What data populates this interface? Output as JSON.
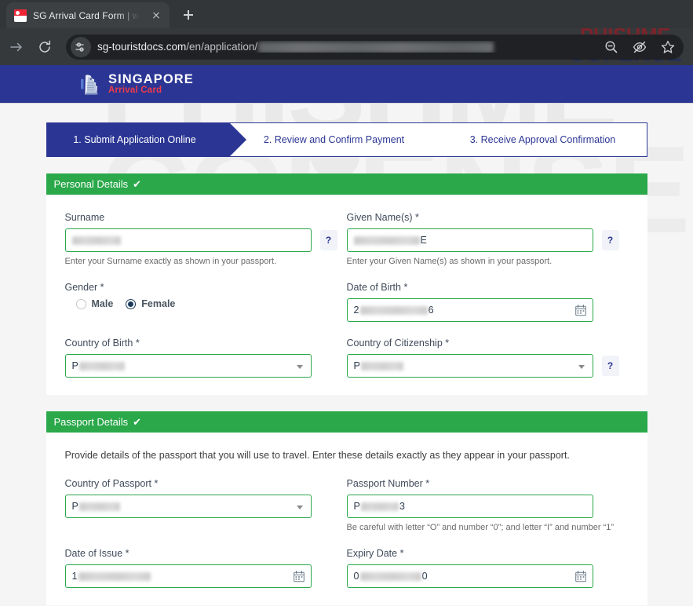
{
  "browser": {
    "tab": {
      "title": "SG Arrival Card Form | www.sg-",
      "favicon": "singapore-flag-icon"
    },
    "new_tab_label": "+",
    "toolbar": {
      "back_icon": "arrow-forward-icon",
      "reload_icon": "reload-icon",
      "site_settings_icon": "tune-icon",
      "zoom_out_icon": "zoom-out-icon",
      "eye_off_icon": "eye-off-icon",
      "bookmark_icon": "star-icon"
    },
    "url": {
      "host": "sg-touristdocs.com",
      "path": "/en/application/",
      "redacted_tail": true
    }
  },
  "watermark": {
    "line1": "PHISHME",
    "line2": "COFENSE"
  },
  "site": {
    "logo_line1": "SINGAPORE",
    "logo_line2": "Arrival Card",
    "logo_icon": "merlion-statue-icon"
  },
  "stepper": {
    "steps": [
      {
        "label": "1. Submit Application Online",
        "active": true
      },
      {
        "label": "2. Review and Confirm Payment",
        "active": false
      },
      {
        "label": "3. Receive Approval Confirmation",
        "active": false
      }
    ]
  },
  "personal_details": {
    "title": "Personal Details",
    "check": "✔",
    "surname": {
      "label": "Surname",
      "value": "",
      "value_redacted": true,
      "help": "Enter your Surname exactly as shown in your passport.",
      "help_icon": "?"
    },
    "given_names": {
      "label": "Given Name(s) *",
      "value_suffix": "E",
      "value_redacted": true,
      "help": "Enter your Given Name(s) as shown in your passport.",
      "help_icon": "?"
    },
    "gender": {
      "label": "Gender *",
      "options": [
        {
          "label": "Male",
          "selected": false
        },
        {
          "label": "Female",
          "selected": true
        }
      ]
    },
    "date_of_birth": {
      "label": "Date of Birth *",
      "value_prefix": "2",
      "value_suffix": "6",
      "value_redacted": true,
      "icon": "calendar-icon"
    },
    "country_of_birth": {
      "label": "Country of Birth *",
      "value_prefix": "P",
      "value_redacted": true,
      "icon": "chevron-down-icon"
    },
    "country_of_citizenship": {
      "label": "Country of Citizenship *",
      "value_prefix": "P",
      "value_redacted": true,
      "icon": "chevron-down-icon",
      "help_icon": "?"
    }
  },
  "passport_details": {
    "title": "Passport Details",
    "check": "✔",
    "intro": "Provide details of the passport that you will use to travel. Enter these details exactly as they appear in your passport.",
    "country_of_passport": {
      "label": "Country of Passport *",
      "value_prefix": "P",
      "value_redacted": true,
      "icon": "chevron-down-icon"
    },
    "passport_number": {
      "label": "Passport Number *",
      "value_prefix": "P",
      "value_suffix": "3",
      "value_redacted": true,
      "help": "Be careful with letter “O” and number “0”; and letter “I” and number “1”"
    },
    "date_of_issue": {
      "label": "Date of Issue *",
      "value_prefix": "1",
      "value_redacted": true,
      "icon": "calendar-icon"
    },
    "expiry_date": {
      "label": "Expiry Date *",
      "value_prefix": "0",
      "value_suffix": "0",
      "value_redacted": true,
      "icon": "calendar-icon"
    }
  },
  "colors": {
    "brand_blue": "#2b3694",
    "brand_red": "#ee3b4b",
    "section_green": "#2aa84a",
    "field_border_green": "#2aa84a"
  }
}
